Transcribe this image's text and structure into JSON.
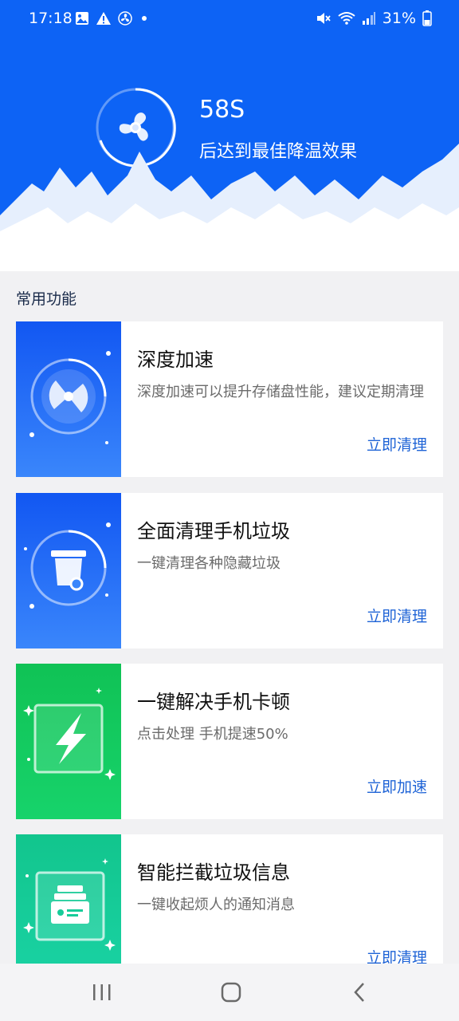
{
  "status_bar": {
    "time": "17:18",
    "battery": "31%",
    "icons_left": [
      "image-icon",
      "warning-icon",
      "fan-icon",
      "dot-icon"
    ],
    "icons_right": [
      "mute-icon",
      "wifi-icon",
      "signal-icon",
      "battery-icon"
    ]
  },
  "hero": {
    "timer_value": "58S",
    "timer_text": "后达到最佳降温效果",
    "icon": "fan-icon",
    "colors": {
      "background": "#0d63f5",
      "snow": "#ffffff"
    }
  },
  "section": {
    "title": "常用功能"
  },
  "cards": [
    {
      "title": "深度加速",
      "desc": "深度加速可以提升存储盘性能，建议定期清理",
      "action": "立即清理",
      "icon": "disk-icon",
      "color": "#1a63f3"
    },
    {
      "title": "全面清理手机垃圾",
      "desc": "一键清理各种隐藏垃圾",
      "action": "立即清理",
      "icon": "trash-icon",
      "color": "#1a63f3"
    },
    {
      "title": "一键解决手机卡顿",
      "desc": "点击处理 手机提速50%",
      "action": "立即加速",
      "icon": "lightning-icon",
      "color": "#12c15a"
    },
    {
      "title": "智能拦截垃圾信息",
      "desc": "一键收起烦人的通知消息",
      "action": "立即清理",
      "icon": "message-block-icon",
      "color": "#14c79a"
    }
  ],
  "navbar": {
    "buttons": [
      "recent-apps-icon",
      "home-icon",
      "back-icon"
    ]
  }
}
